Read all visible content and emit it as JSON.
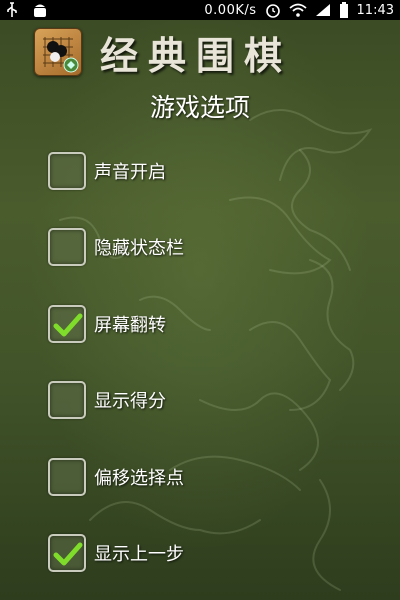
{
  "status_bar": {
    "speed": "0.00K/s",
    "time": "11:43",
    "icons": [
      "usb-icon",
      "android-icon",
      "alarm-icon",
      "wifi-icon",
      "signal-icon",
      "battery-icon"
    ]
  },
  "header": {
    "app_title": "经典围棋",
    "app_icon": "go-board-icon"
  },
  "page": {
    "title": "游戏选项"
  },
  "options": [
    {
      "label": "声音开启",
      "checked": false
    },
    {
      "label": "隐藏状态栏",
      "checked": false
    },
    {
      "label": "屏幕翻转",
      "checked": true
    },
    {
      "label": "显示得分",
      "checked": false
    },
    {
      "label": "偏移选择点",
      "checked": false
    },
    {
      "label": "显示上一步",
      "checked": true
    }
  ],
  "colors": {
    "check": "#7fdc2a",
    "background": "#42552a"
  }
}
